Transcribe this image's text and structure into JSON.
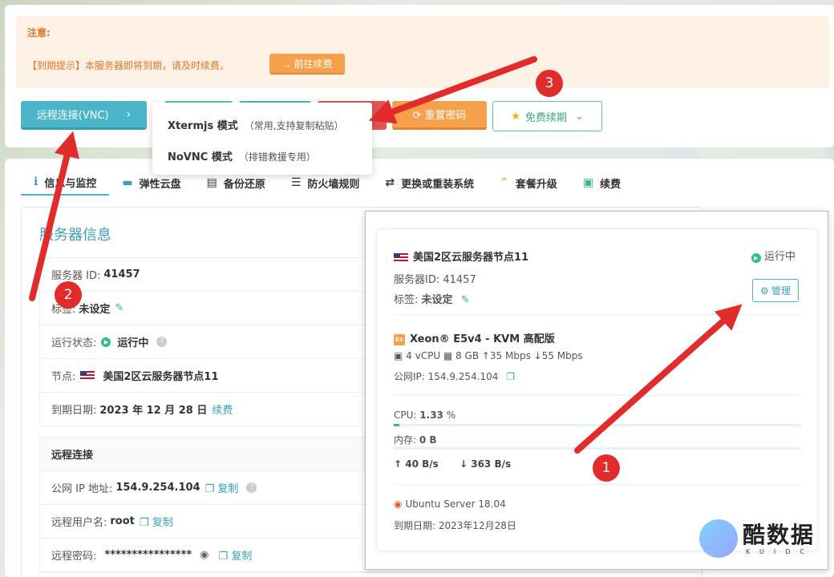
{
  "notice": {
    "title": "注意:",
    "text": "【到期提示】本服务器即将到期，请及时续费。",
    "renew_button": "→ 前往续费"
  },
  "toolbar": {
    "vnc_button": "远程连接(VNC)",
    "vnc_chevron": "›",
    "reset_password": "⟳ 重置密码",
    "free_renew": "免费续期",
    "free_renew_icon": "★",
    "free_renew_chevron": "⌄"
  },
  "vnc_dropdown": [
    {
      "mode": "Xtermjs 模式",
      "note": "（常用,支持复制粘贴）"
    },
    {
      "mode": "NoVNC 模式",
      "note": "（排错救援专用）"
    }
  ],
  "tabs": [
    {
      "icon": "ℹ",
      "label": "信息与监控"
    },
    {
      "icon": "▬",
      "label": "弹性云盘"
    },
    {
      "icon": "▤",
      "label": "备份还原"
    },
    {
      "icon": "☰",
      "label": "防火墙规则"
    },
    {
      "icon": "⇄",
      "label": "更换或重装系统"
    },
    {
      "icon": "⌃",
      "label": "套餐升级"
    },
    {
      "icon": "▣",
      "label": "续费"
    }
  ],
  "server_info": {
    "title": "服务器信息",
    "id_label": "服务器 ID:",
    "id_value": "41457",
    "tag_label": "标签:",
    "tag_value": "未设定",
    "status_label": "运行状态:",
    "status_value": "运行中",
    "node_label": "节点:",
    "node_value": "美国2区云服务器节点11",
    "expire_label": "到期日期:",
    "expire_value": "2023 年 12 月 28 日",
    "renew_link": "续费"
  },
  "remote": {
    "title": "远程连接",
    "ip_label": "公网 IP 地址:",
    "ip_value": "154.9.254.104",
    "copy": "复制",
    "user_label": "远程用户名:",
    "user_value": "root",
    "pass_label": "远程密码:",
    "pass_value": "****************"
  },
  "overlay_card": {
    "node": "美国2区云服务器节点11",
    "status": "运行中",
    "server_id": "服务器ID: 41457",
    "tag_label": "标签:",
    "tag_value": "未设定",
    "manage": "管理",
    "cpu_model": "Xeon® E5v4 - KVM 高配版",
    "cpu_badge": "E5",
    "specs": "▣ 4 vCPU  ▦ 8 GB  ↑35 Mbps  ↓55 Mbps",
    "ip": "公网IP:  154.9.254.104",
    "cpu_label": "CPU:",
    "cpu_usage": "1.33",
    "cpu_unit": "%",
    "cpu_fraction": 0.0133,
    "mem_label": "内存:",
    "mem_value": "0 B",
    "net_up": "↑  40 B/s",
    "net_down": "↓  363 B/s",
    "os": "Ubuntu Server 18.04",
    "expire": "到期日期: 2023年12月28日"
  },
  "annotations": [
    "1",
    "2",
    "3"
  ],
  "watermark": {
    "text": "酷数据",
    "sub": "KUIDC"
  },
  "colors": {
    "accent": "#4bb5c9",
    "orange": "#f5a04a",
    "green": "#2fbf7e",
    "arrow": "#e22b2b"
  }
}
